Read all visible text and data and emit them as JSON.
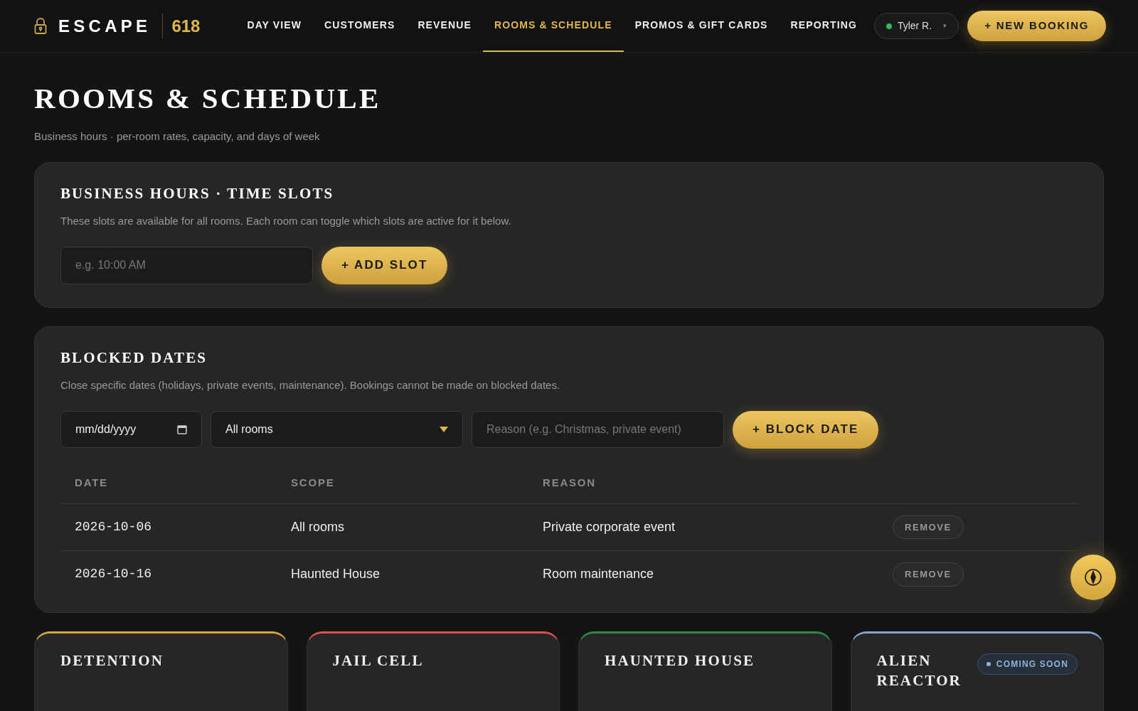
{
  "nav": {
    "brand": "ESCAPE",
    "brand_number": "618",
    "tabs": [
      {
        "label": "DAY VIEW",
        "selected": false
      },
      {
        "label": "CUSTOMERS",
        "selected": false
      },
      {
        "label": "REVENUE",
        "selected": false
      },
      {
        "label": "ROOMS & SCHEDULE",
        "selected": true
      },
      {
        "label": "PROMOS & GIFT CARDS",
        "selected": false
      },
      {
        "label": "REPORTING",
        "selected": false
      }
    ],
    "user": {
      "name": "Tyler R.",
      "caret": "▾"
    },
    "new_booking": "+ NEW BOOKING"
  },
  "page": {
    "title": "ROOMS & SCHEDULE",
    "subtitle": "Business hours · per-room rates, capacity, and days of week"
  },
  "business_hours": {
    "title": "BUSINESS HOURS · TIME SLOTS",
    "description": "These slots are available for all rooms. Each room can toggle which slots are active for it below.",
    "slot_field": {
      "placeholder": "e.g. 10:00 AM"
    },
    "add_button": "+ ADD SLOT"
  },
  "blocked_dates": {
    "title": "BLOCKED DATES",
    "description": "Close specific dates (holidays, private events, maintenance). Bookings cannot be made on blocked dates.",
    "date_field": {
      "placeholder": "mm/dd/yyyy"
    },
    "scope_select": {
      "value": "All rooms"
    },
    "reason_field": {
      "placeholder": "Reason (e.g. Christmas, private event)"
    },
    "block_button": "+ BLOCK DATE",
    "table": {
      "columns": [
        "DATE",
        "SCOPE",
        "REASON"
      ],
      "rows": [
        {
          "date": "2026-10-06",
          "scope": "All rooms",
          "reason": "Private corporate event",
          "action": "REMOVE"
        },
        {
          "date": "2026-10-16",
          "scope": "Haunted House",
          "reason": "Room maintenance",
          "action": "REMOVE"
        }
      ]
    }
  },
  "rooms": [
    {
      "name": "DETENTION",
      "color": "#d4a83f"
    },
    {
      "name": "JAIL CELL",
      "color": "#d9534f"
    },
    {
      "name": "HAUNTED HOUSE",
      "color": "#2e8b4a"
    },
    {
      "name": "ALIEN REACTOR",
      "color": "#7fa6cf",
      "badge": "COMING SOON"
    }
  ]
}
